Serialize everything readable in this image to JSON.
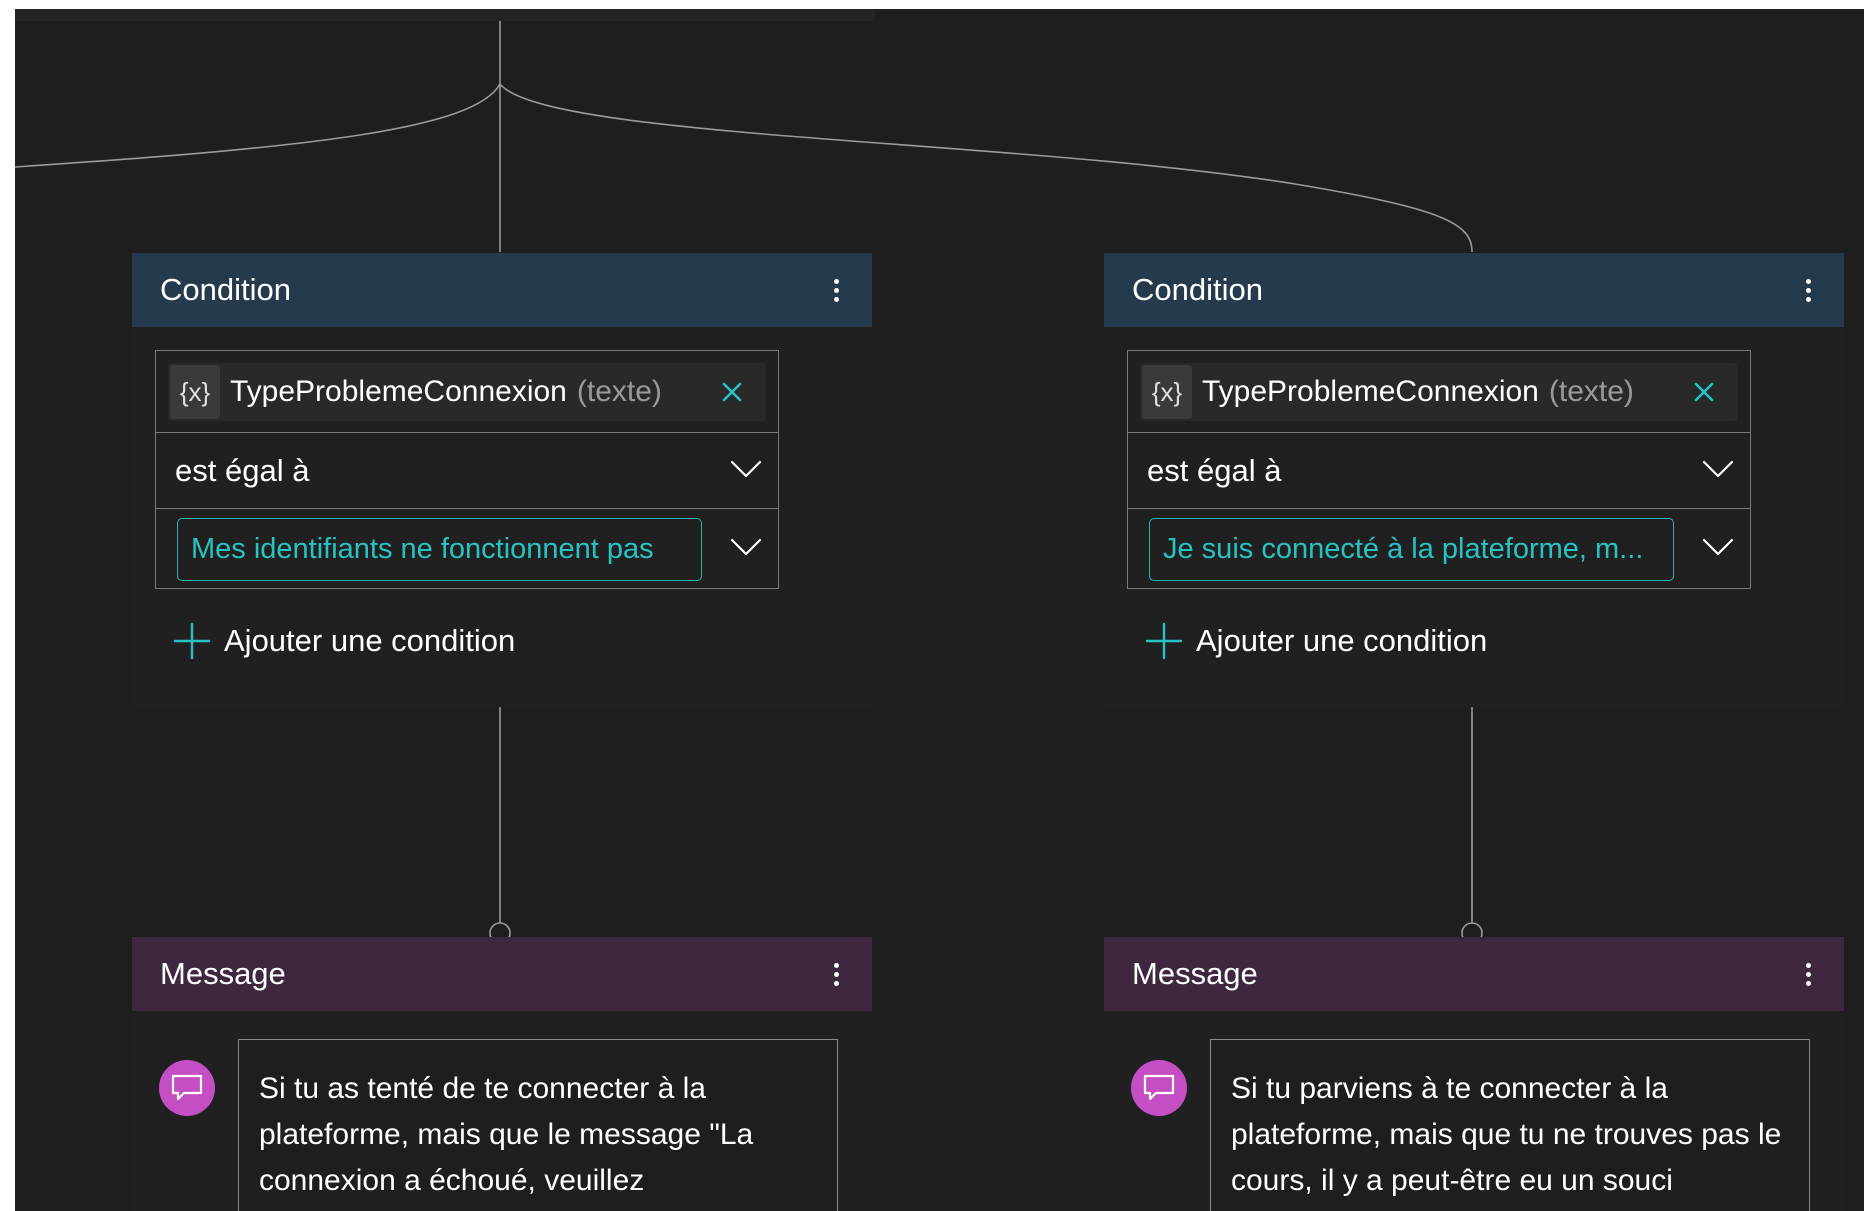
{
  "canvas": {
    "colors": {
      "background": "#1e1e1e",
      "condition_header": "#253b4d",
      "message_header": "#3f283f",
      "accent_teal": "#1fb5b5",
      "message_icon": "#c44fc4",
      "connector": "#9a9a9a"
    }
  },
  "conditions": [
    {
      "title": "Condition",
      "variable": {
        "icon": "{x}",
        "name": "TypeProblemeConnexion",
        "type": "(texte)"
      },
      "operator": "est égal à",
      "value": "Mes identifiants ne fonctionnent pas",
      "add_label": "Ajouter une condition"
    },
    {
      "title": "Condition",
      "variable": {
        "icon": "{x}",
        "name": "TypeProblemeConnexion",
        "type": "(texte)"
      },
      "operator": "est égal à",
      "value": "Je suis connecté à la plateforme, m...",
      "add_label": "Ajouter une condition"
    }
  ],
  "messages": [
    {
      "title": "Message",
      "text": "Si tu as tenté de te connecter à la plateforme, mais que le message \"La connexion a échoué, veuillez"
    },
    {
      "title": "Message",
      "text": "Si tu parviens à te connecter à la plateforme, mais que tu ne trouves pas le cours, il y a peut-être eu un souci"
    }
  ],
  "icons": {
    "variable": "variable-icon",
    "remove": "close-icon",
    "dropdown": "chevron-down-icon",
    "add": "plus-icon",
    "more": "more-vertical-icon",
    "message": "chat-bubble-icon"
  }
}
